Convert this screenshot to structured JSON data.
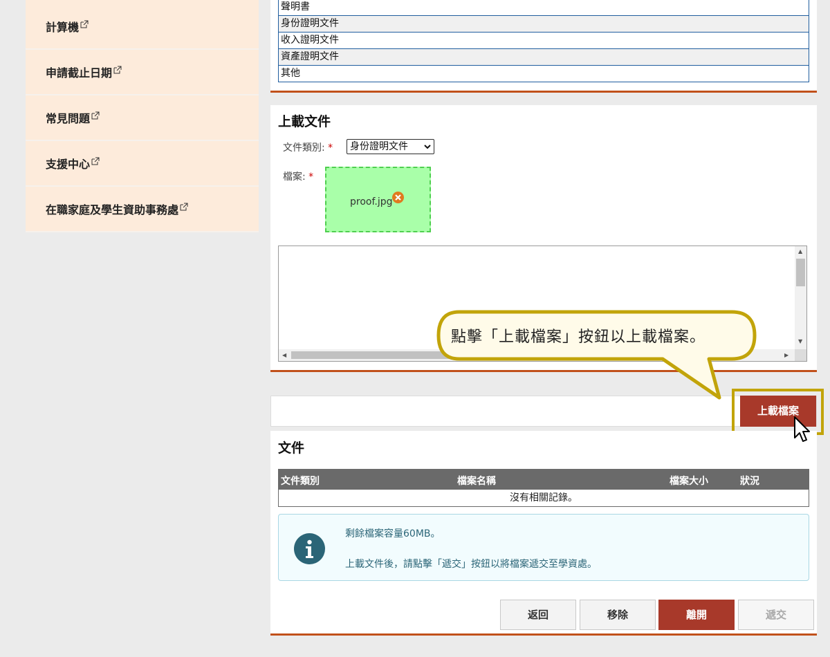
{
  "sidebar": {
    "items": [
      {
        "label": "計算機"
      },
      {
        "label": "申請截止日期"
      },
      {
        "label": "常見問題"
      },
      {
        "label": "支援中心"
      },
      {
        "label": "在職家庭及學生資助事務處"
      }
    ]
  },
  "type_list": [
    "聲明書",
    "身份證明文件",
    "收入證明文件",
    "資產證明文件",
    "其他"
  ],
  "upload": {
    "title": "上載文件",
    "doc_type_label": "文件類別:",
    "required_mark": "*",
    "doc_type_value": "身份證明文件",
    "file_label": "檔案:",
    "file_name": "proof.jpg",
    "upload_button": "上載檔案"
  },
  "callout": "點擊「上載檔案」按鈕以上載檔案。",
  "documents": {
    "title": "文件",
    "columns": [
      "文件類別",
      "檔案名稱",
      "檔案大小",
      "狀況"
    ],
    "empty_text": "沒有相關記錄。",
    "info_line1": "剩餘檔案容量60MB。",
    "info_line2": "上載文件後，請點擊「遞交」按鈕以將檔案遞交至學資處。",
    "buttons": {
      "back": "返回",
      "remove": "移除",
      "leave": "離開",
      "submit": "遞交"
    }
  },
  "colors": {
    "accent": "#c1501a",
    "button_dark": "#a8392a",
    "highlight": "#c2a40a",
    "sidebar_bg": "#fdebdb"
  }
}
